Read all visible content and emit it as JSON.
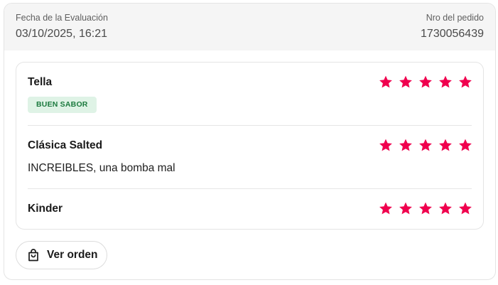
{
  "header": {
    "date_label": "Fecha de la Evaluación",
    "date_value": "03/10/2025, 16:21",
    "order_label": "Nro del pedido",
    "order_value": "1730056439"
  },
  "items": [
    {
      "name": "Tella",
      "rating": 5,
      "tag": "BUEN SABOR"
    },
    {
      "name": "Clásica Salted",
      "rating": 5,
      "comment": "INCREIBLES, una bomba mal"
    },
    {
      "name": "Kinder",
      "rating": 5
    }
  ],
  "actions": {
    "view_order": "Ver orden"
  },
  "icons": {
    "star": "star-icon",
    "order": "shopping-bag-icon"
  },
  "colors": {
    "star": "#f0004e",
    "tag_bg": "#dff3e6",
    "tag_text": "#1b7a3e"
  }
}
